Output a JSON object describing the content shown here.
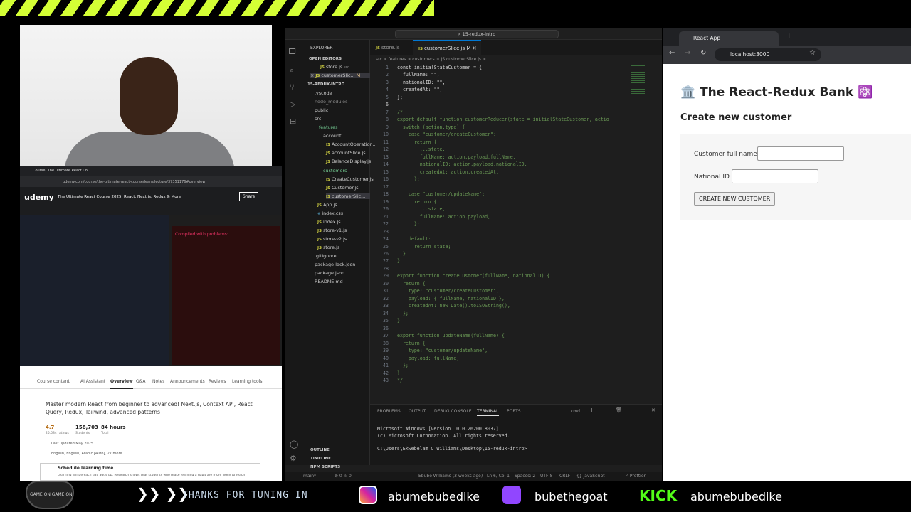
{
  "stream": {
    "tuning": "THANKS FOR TUNING IN",
    "instagram": "abumebubedike",
    "twitch": "bubethegoat",
    "kick_logo": "KICK",
    "kick": "abumebubedike",
    "badge": "GAME ON GAME ON",
    "arrows": "❯❯ ❯❯"
  },
  "udemy": {
    "tab": "Course: The Ultimate React Co",
    "url": "udemy.com/course/the-ultimate-react-course/learn/lecture/37351176#overview",
    "logo": "udemy",
    "course_title": "The Ultimate React Course 2025: React, Next.js, Redux & More",
    "share": "Share",
    "compiled": "Compiled with problems:",
    "tabs": [
      "Course content",
      "AI Assistant",
      "Overview",
      "Q&A",
      "Notes",
      "Announcements",
      "Reviews",
      "Learning tools"
    ],
    "desc": "Master modern React from beginner to advanced! Next.js, Context API, React Query, Redux, Tailwind, advanced patterns",
    "rating": "4.7",
    "ratings_label": "25,584 ratings",
    "students": "158,703",
    "students_label": "Students",
    "hours": "84 hours",
    "hours_label": "Total",
    "updated": "Last updated May 2025",
    "lang": "English, English, Arabic [Auto], 27 more",
    "schedule": "Schedule learning time",
    "schedule_sub": "Learning a little each day adds up. Research shows that students who make learning a habit are more likely to reach"
  },
  "vscode": {
    "search": "15-redux-intro",
    "explorer": "EXPLORER",
    "open_editors": "OPEN EDITORS",
    "open_files": [
      {
        "name": "store.js",
        "extra": "src"
      },
      {
        "name": "customerSlic...",
        "extra": "M"
      }
    ],
    "project": "15-REDUX-INTRO",
    "tree": [
      ".vscode",
      "node_modules",
      "public",
      "src",
      "features",
      "account",
      "AccountOperation...",
      "accountSlice.js",
      "BalanceDisplay.js",
      "customers",
      "CreateCustomer.js",
      "Customer.js",
      "customerSlic...",
      "App.js",
      "index.css",
      "index.js",
      "store-v1.js",
      "store-v2.js",
      "store.js",
      ".gitignore",
      "package-lock.json",
      "package.json",
      "README.md"
    ],
    "outline": "OUTLINE",
    "timeline": "TIMELINE",
    "npm": "NPM SCRIPTS",
    "tabs": [
      {
        "name": "store.js",
        "mod": ""
      },
      {
        "name": "customerSlice.js",
        "mod": "M"
      }
    ],
    "breadcrumb": "src > features > customers > JS customerSlice.js > ...",
    "code": [
      "const initialStateCustomer = {",
      "  fullName: \"\",",
      "  nationalID: \"\",",
      "  createdAt: \"\",",
      "};",
      "",
      "/*",
      "export default function customerReducer(state = initialStateCustomer, actio",
      "  switch (action.type) {",
      "    case \"customer/createCustomer\":",
      "      return {",
      "        ...state,",
      "        fullName: action.payload.fullName,",
      "        nationalID: action.payload.nationalID,",
      "        createdAt: action.createdAt,",
      "      };",
      "",
      "    case \"customer/updateName\":",
      "      return {",
      "        ...state,",
      "        fullName: action.payload,",
      "      };",
      "",
      "    default:",
      "      return state;",
      "  }",
      "}",
      "",
      "export function createCustomer(fullName, nationalID) {",
      "  return {",
      "    type: \"customer/createCustomer\",",
      "    payload: { fullName, nationalID },",
      "    createdAt: new Date().toISOString(),",
      "  };",
      "}",
      "",
      "export function updateName(fullName) {",
      "  return {",
      "    type: \"customer/updateName\",",
      "    payload: fullName,",
      "  };",
      "}",
      "*/"
    ],
    "panel_tabs": [
      "PROBLEMS",
      "OUTPUT",
      "DEBUG CONSOLE",
      "TERMINAL",
      "PORTS"
    ],
    "terminal_shell": "cmd",
    "terminal": [
      "Microsoft Windows [Version 10.0.26200.8037]",
      "(c) Microsoft Corporation. All rights reserved.",
      "",
      "C:\\Users\\Ekwebelam C Williams\\Desktop\\15-redux-intro>"
    ],
    "status": {
      "branch": "main*",
      "errors": "⊗ 0 ⚠ 0",
      "blame": "Ebube Williams (3 weeks ago)",
      "pos": "Ln 6, Col 1",
      "spaces": "Spaces: 2",
      "enc": "UTF-8",
      "eol": "CRLF",
      "lang": "{} JavaScript",
      "prettier": "✓ Prettier"
    }
  },
  "browser": {
    "tab": "React App",
    "url": "localhost:3000",
    "title": "🏛️ The React-Redux Bank ⚛️",
    "subtitle": "Create new customer",
    "label_name": "Customer full name",
    "label_id": "National ID",
    "button": "CREATE NEW CUSTOMER",
    "name_value": "",
    "id_value": ""
  }
}
